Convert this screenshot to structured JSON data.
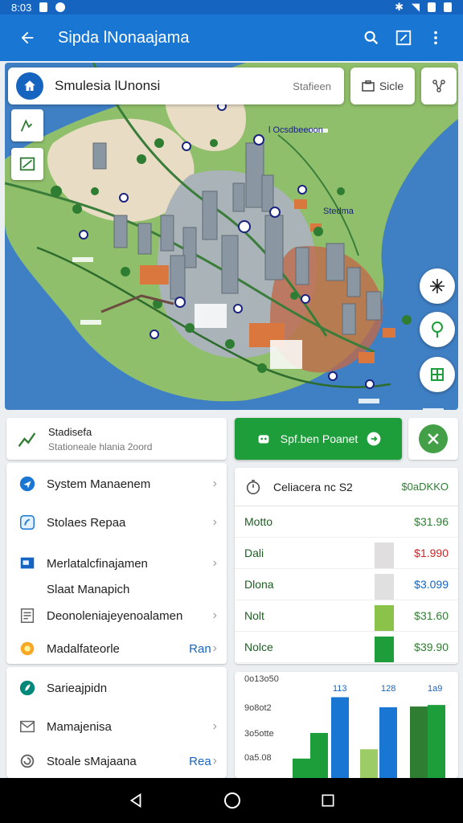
{
  "status_bar": {
    "time": "8:03"
  },
  "app_bar": {
    "title": "Sipda lNonaajama"
  },
  "search": {
    "query": "Smulesia lUnonsi",
    "hint": "Stafieen"
  },
  "chips": [
    {
      "label": "Sicle"
    }
  ],
  "map_labels": [
    "l Ocsdbeeoon",
    "Stedma"
  ],
  "stats_card": {
    "title": "Stadisefa",
    "subtitle": "Stationeale hlania 2oord"
  },
  "report_button": {
    "label": "Spf.ben Poanet"
  },
  "menu_primary": [
    {
      "label": "System Manaenem",
      "icon": "navigation-icon"
    },
    {
      "label": "Stolaes Repaa",
      "icon": "shield-icon"
    },
    {
      "label": "Merlatalcfinajamen",
      "icon": "image-icon"
    },
    {
      "label": "Slaat Manapich",
      "icon": ""
    },
    {
      "label": "Deonoleniajeyenoalamen",
      "icon": "document-icon"
    },
    {
      "label": "Madalfateorle",
      "icon": "coin-icon",
      "tag": "Ran"
    }
  ],
  "menu_secondary": [
    {
      "label": "Sarieajpidn",
      "icon": "leaf-icon"
    },
    {
      "label": "Mamajenisa",
      "icon": "mail-icon"
    },
    {
      "label": "Stoale sMajaana",
      "icon": "swirl-icon",
      "tag": "Rea"
    }
  ],
  "cost_panel": {
    "title": "Celiacera nc S2",
    "total": "$0aDKKO",
    "rows": [
      {
        "name": "Motto",
        "value": "$31.96",
        "color": "#2e7d32"
      },
      {
        "name": "Dali",
        "value": "$1.990",
        "color": "#c62828",
        "bar_color": "#e0dede"
      },
      {
        "name": "Dlona",
        "value": "$3.099",
        "color": "#1565c0",
        "bar_color": "#e0e0e0"
      },
      {
        "name": "Nolt",
        "value": "$31.60",
        "color": "#2e7d32",
        "bar_color": "#8bc34a"
      },
      {
        "name": "Nolce",
        "value": "$39.90",
        "color": "#2e7d32",
        "bar_color": "#1e9e3a"
      }
    ]
  },
  "chart_data": {
    "type": "bar",
    "y_tick_labels": [
      "0o13o50",
      "9o8ot2",
      "3o5otte",
      "0a5.08"
    ],
    "data_labels": [
      "113",
      "128",
      "1a9"
    ],
    "series": [
      {
        "values": [
          22,
          37,
          8,
          0,
          57
        ],
        "color": "#9ccc65"
      },
      {
        "values": [
          0,
          58,
          25,
          37,
          0
        ],
        "color": "#1e9e3a"
      },
      {
        "values": [
          0,
          104,
          0,
          91,
          0
        ],
        "color": "#1976d2"
      },
      {
        "values": [
          0,
          0,
          0,
          0,
          92
        ],
        "color": "#2e7d32"
      }
    ]
  },
  "colors": {
    "primary": "#1976d2",
    "accent": "#1e9e3a",
    "positive": "#2e7d32",
    "negative": "#c62828"
  }
}
